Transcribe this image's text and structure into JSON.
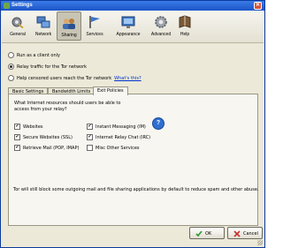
{
  "window": {
    "title": "Settings",
    "close_glyph": "✕"
  },
  "toolbar": {
    "items": [
      {
        "label": "General",
        "icon": "gear-wrench-icon"
      },
      {
        "label": "Network",
        "icon": "network-icon"
      },
      {
        "label": "Sharing",
        "icon": "sharing-icon",
        "selected": true
      },
      {
        "label": "Services",
        "icon": "services-icon"
      },
      {
        "label": "Appearance",
        "icon": "appearance-icon"
      },
      {
        "label": "Advanced",
        "icon": "advanced-gear-icon"
      },
      {
        "label": "Help",
        "icon": "help-icon"
      }
    ]
  },
  "mode": {
    "client_only": "Run as a client only",
    "relay": "Relay traffic for the Tor network",
    "bridge": "Help censored users reach the Tor network",
    "whats_this": "What's this?"
  },
  "tabs": {
    "basic": "Basic Settings",
    "bandwidth": "Bandwidth Limits",
    "exit": "Exit Policies"
  },
  "exit_policies": {
    "question": "What Internet resources should users be able to access from your relay?",
    "options": {
      "websites": {
        "label": "Websites",
        "checked": true
      },
      "secure_websites": {
        "label": "Secure Websites (SSL)",
        "checked": true
      },
      "retrieve_mail": {
        "label": "Retrieve Mail (POP, IMAP)",
        "checked": true
      },
      "instant_messaging": {
        "label": "Instant Messaging (IM)",
        "checked": true
      },
      "irc": {
        "label": "Internet Relay Chat (IRC)",
        "checked": true
      },
      "misc": {
        "label": "Misc Other Services",
        "checked": false
      }
    },
    "help_glyph": "?",
    "note": "Tor will still block some outgoing mail and file sharing applications by default to reduce spam and other abuse."
  },
  "buttons": {
    "ok": "OK",
    "cancel": "Cancel"
  },
  "check_glyph": "✔",
  "colors": {
    "titlebar": "#1c54c7",
    "link": "#0033cc",
    "panel": "#f7f6f1"
  }
}
